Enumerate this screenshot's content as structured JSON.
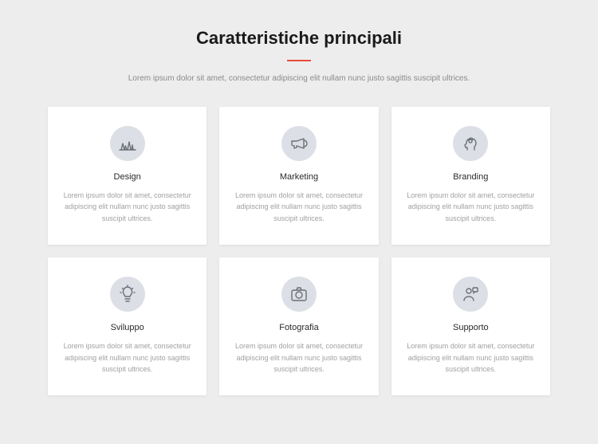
{
  "header": {
    "title": "Caratteristiche principali",
    "subtitle": "Lorem ipsum dolor sit amet, consectetur adipiscing elit nullam nunc justo sagittis suscipit ultrices."
  },
  "cards": [
    {
      "title": "Design",
      "desc": "Lorem ipsum dolor sit amet, consectetur adipiscing elit nullam nunc justo sagittis suscipit ultrices."
    },
    {
      "title": "Marketing",
      "desc": "Lorem ipsum dolor sit amet, consectetur adipiscing elit nullam nunc justo sagittis suscipit ultrices."
    },
    {
      "title": "Branding",
      "desc": "Lorem ipsum dolor sit amet, consectetur adipiscing elit nullam nunc justo sagittis suscipit ultrices."
    },
    {
      "title": "Sviluppo",
      "desc": "Lorem ipsum dolor sit amet, consectetur adipiscing elit nullam nunc justo sagittis suscipit ultrices."
    },
    {
      "title": "Fotografia",
      "desc": "Lorem ipsum dolor sit amet, consectetur adipiscing elit nullam nunc justo sagittis suscipit ultrices."
    },
    {
      "title": "Supporto",
      "desc": "Lorem ipsum dolor sit amet, consectetur adipiscing elit nullam nunc justo sagittis suscipit ultrices."
    }
  ]
}
